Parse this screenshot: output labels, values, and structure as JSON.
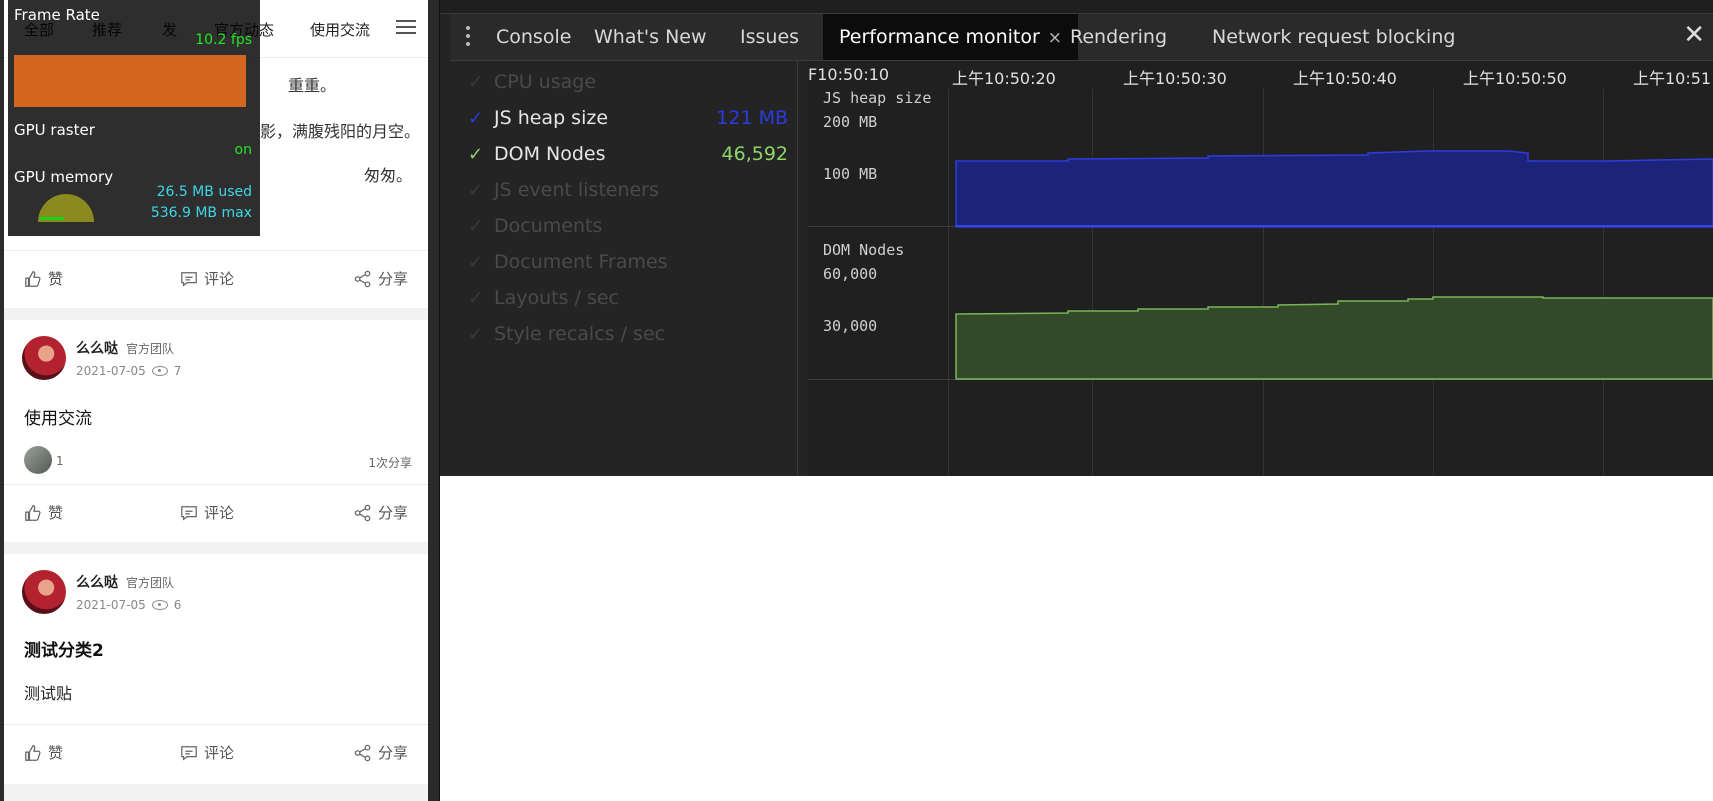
{
  "feed": {
    "nav_tabs": [
      "全部",
      "推荐",
      "发",
      "官方动态",
      "使用交流"
    ],
    "partial_lines": [
      "重重。",
      "影，满腹残阳的月空。",
      "匆匆。"
    ],
    "actions": {
      "like": "赞",
      "comment": "评论",
      "share": "分享"
    },
    "posts": [
      {
        "author": "么么哒",
        "tag": "官方团队",
        "date": "2021-07-05",
        "views": "7",
        "title": "使用交流",
        "body": "",
        "likes_count": "1",
        "share_count": "1次分享"
      },
      {
        "author": "么么哒",
        "tag": "官方团队",
        "date": "2021-07-05",
        "views": "6",
        "title": "测试分类2",
        "body": "测试贴"
      }
    ]
  },
  "fps_overlay": {
    "frame_rate_label": "Frame Rate",
    "fps_value": "10.2 fps",
    "gpu_raster_label": "GPU raster",
    "gpu_raster_value": "on",
    "gpu_memory_label": "GPU memory",
    "gpu_used": "26.5 MB used",
    "gpu_max": "536.9 MB max",
    "colors": {
      "fps": "#22e622",
      "gpu_text": "#3fd6e6",
      "bar_orange": "#d4661f",
      "bar_yellow": "#f2e227",
      "bar_blue": "#86a8c8"
    }
  },
  "devtools": {
    "tabs": [
      "Console",
      "What's New",
      "Issues",
      "Performance monitor",
      "Rendering",
      "Network request blocking"
    ],
    "active_tab": "Performance monitor",
    "close_tab_glyph": "×",
    "close_panel_glyph": "✕",
    "metrics": [
      {
        "label": "CPU usage",
        "checked": false,
        "value": ""
      },
      {
        "label": "JS heap size",
        "checked": true,
        "value": "121 MB",
        "color": "#2b3be0"
      },
      {
        "label": "DOM Nodes",
        "checked": true,
        "value": "46,592",
        "color": "#8fd66a"
      },
      {
        "label": "JS event listeners",
        "checked": false,
        "value": ""
      },
      {
        "label": "Documents",
        "checked": false,
        "value": ""
      },
      {
        "label": "Document Frames",
        "checked": false,
        "value": ""
      },
      {
        "label": "Layouts / sec",
        "checked": false,
        "value": ""
      },
      {
        "label": "Style recalcs / sec",
        "checked": false,
        "value": ""
      }
    ],
    "time_labels": [
      "F10:50:10",
      "上午10:50:20",
      "上午10:50:30",
      "上午10:50:40",
      "上午10:50:50",
      "上午10:51"
    ],
    "heap_graph": {
      "title": "JS heap size",
      "ticks": [
        "200 MB",
        "100 MB"
      ],
      "color": "#1e2a8c"
    },
    "dom_graph": {
      "title": "DOM Nodes",
      "ticks": [
        "60,000",
        "30,000"
      ],
      "color": "#3f5a31"
    }
  }
}
